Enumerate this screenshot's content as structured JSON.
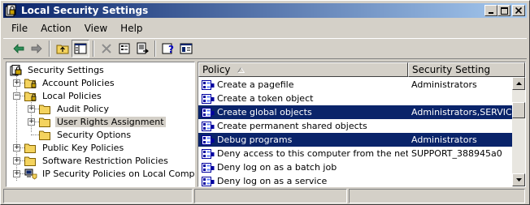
{
  "window": {
    "title": "Local Security Settings"
  },
  "menu": [
    "File",
    "Action",
    "View",
    "Help"
  ],
  "toolbar": {
    "buttons": [
      "back-arrow-icon",
      "forward-arrow-icon",
      "up-folder-icon",
      "show-hide-tree-icon",
      "delete-icon",
      "properties-icon",
      "export-list-icon",
      "help-icon",
      "console-view-icon"
    ]
  },
  "tree": {
    "items": [
      {
        "label": "Security Settings"
      },
      {
        "label": "Account Policies"
      },
      {
        "label": "Local Policies"
      },
      {
        "label": "Audit Policy"
      },
      {
        "label": "User Rights Assignment"
      },
      {
        "label": "Security Options"
      },
      {
        "label": "Public Key Policies"
      },
      {
        "label": "Software Restriction Policies"
      },
      {
        "label": "IP Security Policies on Local Computer"
      }
    ]
  },
  "list": {
    "columns": {
      "policy": "Policy",
      "setting": "Security Setting"
    },
    "rows": [
      {
        "policy": "Create a pagefile",
        "setting": "Administrators",
        "selected": false
      },
      {
        "policy": "Create a token object",
        "setting": "",
        "selected": false
      },
      {
        "policy": "Create global objects",
        "setting": "Administrators,SERVICE",
        "selected": true
      },
      {
        "policy": "Create permanent shared objects",
        "setting": "",
        "selected": false
      },
      {
        "policy": "Debug programs",
        "setting": "Administrators",
        "selected": true
      },
      {
        "policy": "Deny access to this computer from the network",
        "setting": "SUPPORT_388945a0",
        "selected": false
      },
      {
        "policy": "Deny log on as a batch job",
        "setting": "",
        "selected": false
      },
      {
        "policy": "Deny log on as a service",
        "setting": "",
        "selected": false
      }
    ]
  },
  "colors": {
    "title_active": "#0a246a",
    "selection": "#0a246a",
    "face": "#d4d0c8"
  }
}
